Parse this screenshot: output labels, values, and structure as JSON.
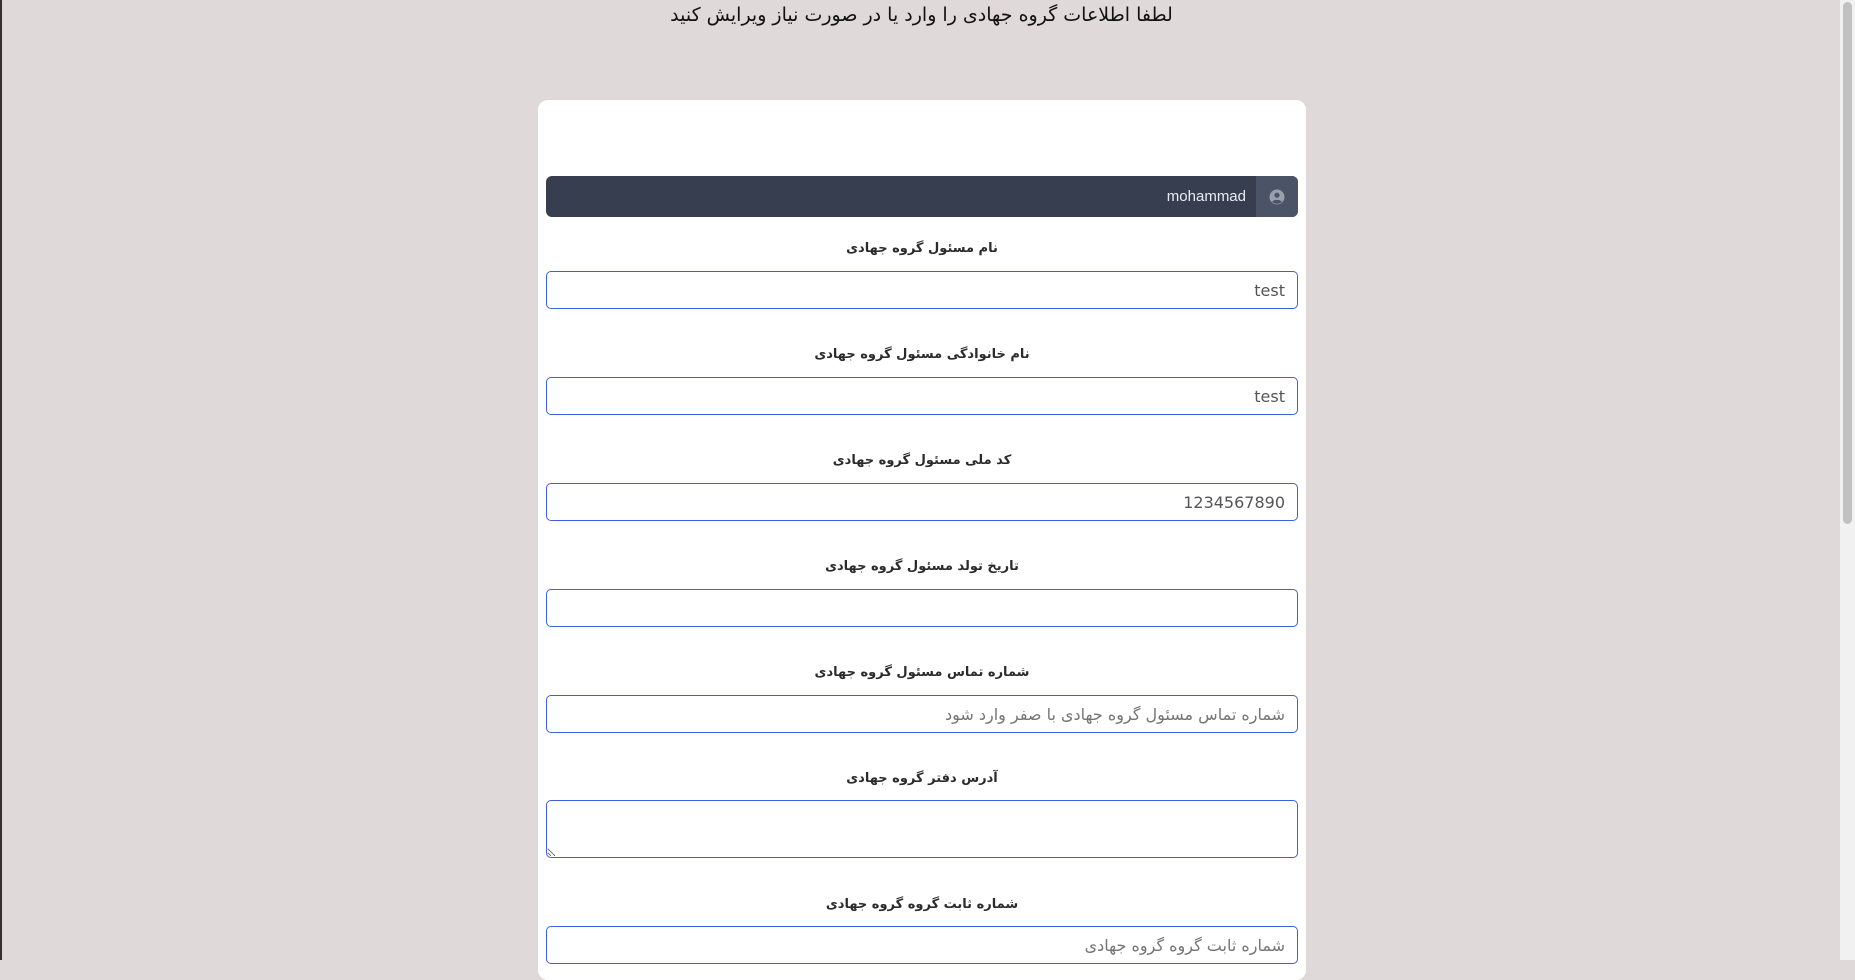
{
  "page": {
    "heading": "لطفا اطلاعات گروه جهادی را وارد یا در صورت نیاز ویرایش کنید"
  },
  "user_bar": {
    "username": "mohammad",
    "icon": "user-circle-icon"
  },
  "form": {
    "fields": [
      {
        "label": "نام مسئول گروه جهادی",
        "value": "test",
        "placeholder": ""
      },
      {
        "label": "نام خانوادگی مسئول گروه جهادی",
        "value": "test",
        "placeholder": ""
      },
      {
        "label": "کد ملی مسئول گروه جهادی",
        "value": "1234567890",
        "placeholder": ""
      },
      {
        "label": "تاریخ تولد مسئول گروه جهادی",
        "value": "",
        "placeholder": ""
      },
      {
        "label": "شماره تماس مسئول گروه جهادی",
        "value": "",
        "placeholder": "شماره تماس مسئول گروه جهادی با صفر وارد شود"
      },
      {
        "label": "آدرس دفتر گروه جهادی",
        "value": "",
        "placeholder": ""
      },
      {
        "label": "شماره ثابت گروه گروه جهادی",
        "value": "",
        "placeholder": "شماره ثابت گروه گروه جهادی"
      }
    ]
  },
  "colors": {
    "background": "#dfd9d9",
    "card": "#ffffff",
    "user_bar": "#363e50",
    "input_border": "#3d5fe0"
  }
}
